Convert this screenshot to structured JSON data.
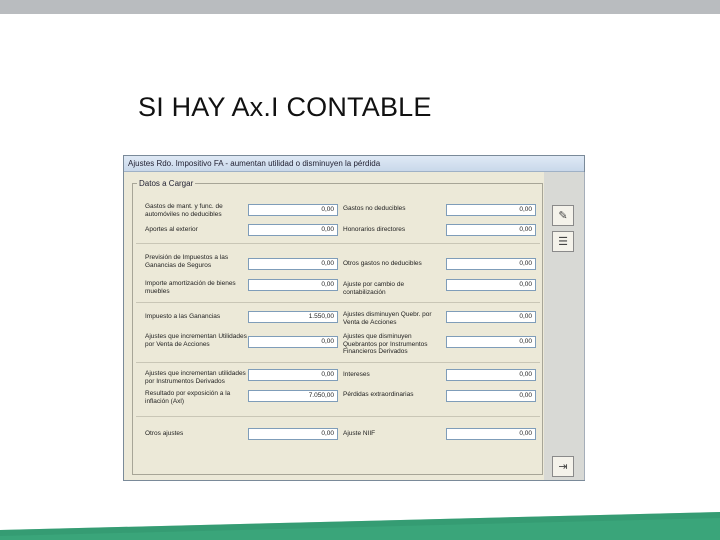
{
  "slide": {
    "title": "SI HAY Ax.I CONTABLE"
  },
  "window": {
    "title": "Ajustes Rdo. Impositivo FA - aumentan utilidad o disminuyen la pérdida",
    "group_label": "Datos a Cargar"
  },
  "fields": [
    {
      "label": "Gastos de mant. y func. de automóviles no deducibles",
      "value": "0,00"
    },
    {
      "label": "Gastos no deducibles",
      "value": "0,00"
    },
    {
      "label": "Aportes al exterior",
      "value": "0,00"
    },
    {
      "label": "Honorarios directores",
      "value": "0,00"
    },
    {
      "label": "Previsión de Impuestos a las Ganancias de Seguros",
      "value": "0,00"
    },
    {
      "label": "Otros gastos no deducibles",
      "value": "0,00"
    },
    {
      "label": "Importe amortización de bienes muebles",
      "value": "0,00"
    },
    {
      "label": "Ajuste por cambio de contabilización",
      "value": "0,00"
    },
    {
      "label": "Impuesto a las Ganancias",
      "value": "1.550,00"
    },
    {
      "label": "Ajustes disminuyen Quebr. por Venta de Acciones",
      "value": "0,00"
    },
    {
      "label": "Ajustes que incrementan Utilidades por Venta de Acciones",
      "value": "0,00"
    },
    {
      "label": "Ajustes que disminuyen Quebrantos por Instrumentos Financieros Derivados",
      "value": "0,00"
    },
    {
      "label": "Ajustes que incrementan utilidades por Instrumentos Derivados",
      "value": "0,00"
    },
    {
      "label": "Intereses",
      "value": "0,00"
    },
    {
      "label": "Resultado por exposición a la inflación (Axl)",
      "value": "7.050,00"
    },
    {
      "label": "Pérdidas extraordinarias",
      "value": "0,00"
    },
    {
      "label": "Otros ajustes",
      "value": "0,00"
    },
    {
      "label": "Ajuste NIIF",
      "value": "0,00"
    }
  ],
  "buttons": {
    "tools_icon": "✎",
    "list_icon": "☰",
    "exit_icon": "⇥"
  },
  "colors": {
    "accent_green": "#3aa57a",
    "window_bg": "#ece9d8"
  }
}
